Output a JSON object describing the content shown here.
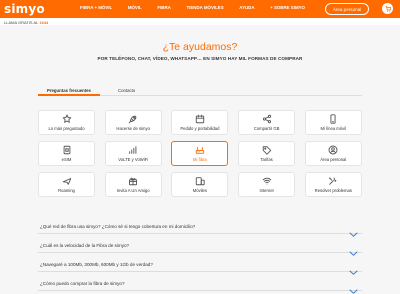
{
  "header": {
    "logo": "simyo",
    "nav": [
      "FIBRA + MÓVIL",
      "MÓVIL",
      "FIBRA",
      "TIENDA MÓVILES",
      "AYUDA",
      "+ SOBRE SIMYO"
    ],
    "area_button": "Área personal",
    "cart_icon": "cart-icon"
  },
  "subheader": {
    "call_prefix": "LLAMA GRATIS AL",
    "call_number": "1644"
  },
  "hero": {
    "title": "¿Te ayudamos?",
    "subtitle": "POR TELÉFONO, CHAT, VÍDEO, WHATSAPP… EN SIMYO HAY MIL FORMAS DE COMPRAR"
  },
  "tabs": [
    {
      "label": "Preguntas frecuentes",
      "active": true
    },
    {
      "label": "Contacto",
      "active": false
    }
  ],
  "categories": [
    {
      "label": "Lo más preguntado",
      "icon": "star-icon"
    },
    {
      "label": "Hacerse de simyo",
      "icon": "rocket-icon"
    },
    {
      "label": "Pedido y portabilidad",
      "icon": "calendar-icon"
    },
    {
      "label": "Compartir GB",
      "icon": "share-icon"
    },
    {
      "label": "Mi línea móvil",
      "icon": "mobile-icon"
    },
    {
      "label": "eSIM",
      "icon": "esim-icon"
    },
    {
      "label": "VoLTE y VoWiFi",
      "icon": "signal-icon"
    },
    {
      "label": "Mi fibra",
      "icon": "router-icon",
      "active": true
    },
    {
      "label": "Tarifas",
      "icon": "tag-icon"
    },
    {
      "label": "Área personal",
      "icon": "user-icon"
    },
    {
      "label": "Roaming",
      "icon": "plane-icon"
    },
    {
      "label": "Invita A Un Amigo",
      "icon": "gift-icon"
    },
    {
      "label": "Móviles",
      "icon": "devices-icon"
    },
    {
      "label": "Internet",
      "icon": "wifi-icon"
    },
    {
      "label": "Resolver problemas",
      "icon": "tools-icon"
    }
  ],
  "faqs": [
    "¿Qué red de fibra usa simyo? ¿Cómo sé si tengo cobertura en mi domicilio?",
    "¿Cuál es la velocidad de la Fibra de simyo?",
    "¿Navegaré a 100Mb, 300Mb, 600Mb y 1Gb de verdad?",
    "¿Cómo puedo comprar la fibra de simyo?"
  ],
  "colors": {
    "brand": "#ff6b00",
    "accent_chevron": "#3a7bd5"
  }
}
